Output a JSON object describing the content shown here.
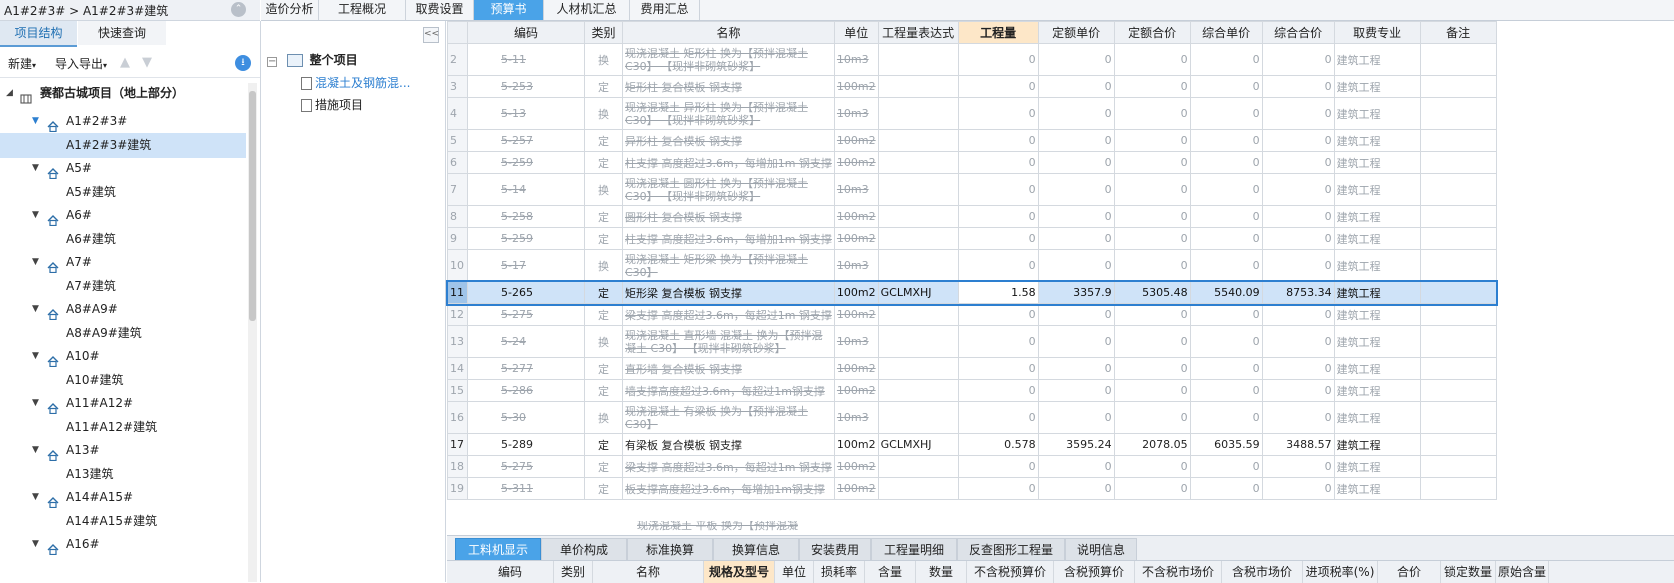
{
  "breadcrumb": "A1#2#3# > A1#2#3#建筑",
  "top_tabs": [
    "造价分析",
    "工程概况",
    "取费设置",
    "预算书",
    "人材机汇总",
    "费用汇总"
  ],
  "active_top_tab": "预算书",
  "left": {
    "tabs": [
      "项目结构",
      "快速查询"
    ],
    "toolbar": {
      "new": "新建",
      "import_export": "导入导出",
      "up_arrow": "▲",
      "down_arrow": "▼",
      "download": "⭳"
    },
    "root": "赛都古城项目（地上部分）",
    "nodes": [
      {
        "name": "A1#2#3#",
        "child": "A1#2#3#建筑"
      },
      {
        "name": "A5#",
        "child": "A5#建筑"
      },
      {
        "name": "A6#",
        "child": "A6#建筑"
      },
      {
        "name": "A7#",
        "child": "A7#建筑"
      },
      {
        "name": "A8#A9#",
        "child": "A8#A9#建筑"
      },
      {
        "name": "A10#",
        "child": "A10#建筑"
      },
      {
        "name": "A11#A12#",
        "child": "A11#A12#建筑"
      },
      {
        "name": "A13#",
        "child": "A13建筑"
      },
      {
        "name": "A14#A15#",
        "child": "A14#A15#建筑"
      },
      {
        "name": "A16#",
        "child": ""
      }
    ],
    "selected": "A1#2#3#建筑"
  },
  "middle": {
    "collapse": "<<",
    "root": "整个项目",
    "items": [
      "混凝土及钢筋混...",
      "措施项目"
    ]
  },
  "grid": {
    "columns": [
      "编码",
      "类别",
      "名称",
      "单位",
      "工程量表达式",
      "工程量",
      "定额单价",
      "定额合价",
      "综合单价",
      "综合合价",
      "取费专业",
      "备注"
    ],
    "rows": [
      {
        "n": "2",
        "code": "5-11",
        "type": "换",
        "name": "现浇混凝土 矩形柱 换为【预拌混凝土 C30】 【现拌非砌筑砂浆】",
        "unit": "10m3",
        "expr": "",
        "qty": "0",
        "up": "0",
        "tp": "0",
        "cup": "0",
        "ctp": "0",
        "spec": "建筑工程",
        "dis": true,
        "tall": true
      },
      {
        "n": "3",
        "code": "5-253",
        "type": "定",
        "name": "矩形柱 复合模板 钢支撑",
        "unit": "100m2",
        "expr": "",
        "qty": "0",
        "up": "0",
        "tp": "0",
        "cup": "0",
        "ctp": "0",
        "spec": "建筑工程",
        "dis": true
      },
      {
        "n": "4",
        "code": "5-13",
        "type": "换",
        "name": "现浇混凝土 异形柱 换为【预拌混凝土 C30】 【现拌非砌筑砂浆】",
        "unit": "10m3",
        "expr": "",
        "qty": "0",
        "up": "0",
        "tp": "0",
        "cup": "0",
        "ctp": "0",
        "spec": "建筑工程",
        "dis": true,
        "tall": true
      },
      {
        "n": "5",
        "code": "5-257",
        "type": "定",
        "name": "异形柱 复合模板 钢支撑",
        "unit": "100m2",
        "expr": "",
        "qty": "0",
        "up": "0",
        "tp": "0",
        "cup": "0",
        "ctp": "0",
        "spec": "建筑工程",
        "dis": true
      },
      {
        "n": "6",
        "code": "5-259",
        "type": "定",
        "name": "柱支撑 高度超过3.6m，每增加1m 钢支撑",
        "unit": "100m2",
        "expr": "",
        "qty": "0",
        "up": "0",
        "tp": "0",
        "cup": "0",
        "ctp": "0",
        "spec": "建筑工程",
        "dis": true
      },
      {
        "n": "7",
        "code": "5-14",
        "type": "换",
        "name": "现浇混凝土 圆形柱 换为【预拌混凝土 C30】 【现拌非砌筑砂浆】",
        "unit": "10m3",
        "expr": "",
        "qty": "0",
        "up": "0",
        "tp": "0",
        "cup": "0",
        "ctp": "0",
        "spec": "建筑工程",
        "dis": true,
        "tall": true
      },
      {
        "n": "8",
        "code": "5-258",
        "type": "定",
        "name": "圆形柱 复合模板 钢支撑",
        "unit": "100m2",
        "expr": "",
        "qty": "0",
        "up": "0",
        "tp": "0",
        "cup": "0",
        "ctp": "0",
        "spec": "建筑工程",
        "dis": true
      },
      {
        "n": "9",
        "code": "5-259",
        "type": "定",
        "name": "柱支撑 高度超过3.6m，每增加1m 钢支撑",
        "unit": "100m2",
        "expr": "",
        "qty": "0",
        "up": "0",
        "tp": "0",
        "cup": "0",
        "ctp": "0",
        "spec": "建筑工程",
        "dis": true
      },
      {
        "n": "10",
        "code": "5-17",
        "type": "换",
        "name": "现浇混凝土 矩形梁 换为【预拌混凝土 C30】",
        "unit": "10m3",
        "expr": "",
        "qty": "0",
        "up": "0",
        "tp": "0",
        "cup": "0",
        "ctp": "0",
        "spec": "建筑工程",
        "dis": true,
        "tall": true
      },
      {
        "n": "11",
        "code": "5-265",
        "type": "定",
        "name": "矩形梁 复合模板 钢支撑",
        "unit": "100m2",
        "expr": "GCLMXHJ",
        "qty": "1.58",
        "up": "3357.9",
        "tp": "5305.48",
        "cup": "5540.09",
        "ctp": "8753.34",
        "spec": "建筑工程",
        "sel": true
      },
      {
        "n": "12",
        "code": "5-275",
        "type": "定",
        "name": "梁支撑 高度超过3.6m，每超过1m 钢支撑",
        "unit": "100m2",
        "expr": "",
        "qty": "0",
        "up": "0",
        "tp": "0",
        "cup": "0",
        "ctp": "0",
        "spec": "建筑工程",
        "dis": true
      },
      {
        "n": "13",
        "code": "5-24",
        "type": "换",
        "name": "现浇混凝土 直形墙 混凝土 换为【预拌混凝土 C30】 【现拌非砌筑砂浆】",
        "unit": "10m3",
        "expr": "",
        "qty": "0",
        "up": "0",
        "tp": "0",
        "cup": "0",
        "ctp": "0",
        "spec": "建筑工程",
        "dis": true,
        "tall": true
      },
      {
        "n": "14",
        "code": "5-277",
        "type": "定",
        "name": "直形墙 复合模板 钢支撑",
        "unit": "100m2",
        "expr": "",
        "qty": "0",
        "up": "0",
        "tp": "0",
        "cup": "0",
        "ctp": "0",
        "spec": "建筑工程",
        "dis": true
      },
      {
        "n": "15",
        "code": "5-286",
        "type": "定",
        "name": "墙支撑高度超过3.6m，每超过1m钢支撑",
        "unit": "100m2",
        "expr": "",
        "qty": "0",
        "up": "0",
        "tp": "0",
        "cup": "0",
        "ctp": "0",
        "spec": "建筑工程",
        "dis": true
      },
      {
        "n": "16",
        "code": "5-30",
        "type": "换",
        "name": "现浇混凝土 有梁板 换为【预拌混凝土 C30】",
        "unit": "10m3",
        "expr": "",
        "qty": "0",
        "up": "0",
        "tp": "0",
        "cup": "0",
        "ctp": "0",
        "spec": "建筑工程",
        "dis": true,
        "tall": true
      },
      {
        "n": "17",
        "code": "5-289",
        "type": "定",
        "name": "有梁板 复合模板 钢支撑",
        "unit": "100m2",
        "expr": "GCLMXHJ",
        "qty": "0.578",
        "up": "3595.24",
        "tp": "2078.05",
        "cup": "6035.59",
        "ctp": "3488.57",
        "spec": "建筑工程"
      },
      {
        "n": "18",
        "code": "5-275",
        "type": "定",
        "name": "梁支撑 高度超过3.6m，每超过1m 钢支撑",
        "unit": "100m2",
        "expr": "",
        "qty": "0",
        "up": "0",
        "tp": "0",
        "cup": "0",
        "ctp": "0",
        "spec": "建筑工程",
        "dis": true
      },
      {
        "n": "19",
        "code": "5-311",
        "type": "定",
        "name": "板支撑高度超过3.6m，每增加1m钢支撑",
        "unit": "100m2",
        "expr": "",
        "qty": "0",
        "up": "0",
        "tp": "0",
        "cup": "0",
        "ctp": "0",
        "spec": "建筑工程",
        "dis": true
      }
    ],
    "partial_row_text": "现浇混凝土 平板 换为【预拌混凝"
  },
  "bottom_tabs": [
    "工料机显示",
    "单价构成",
    "标准换算",
    "换算信息",
    "安装费用",
    "工程量明细",
    "反查图形工程量",
    "说明信息"
  ],
  "active_bottom_tab": "工料机显示",
  "bottom_columns": [
    "编码",
    "类别",
    "名称",
    "规格及型号",
    "单位",
    "损耗率",
    "含量",
    "数量",
    "不含税预算价",
    "含税预算价",
    "不含税市场价",
    "含税市场价",
    "进项税率(%)",
    "合价",
    "锁定数量",
    "原始含量"
  ],
  "colors": {
    "accent": "#4aa3e8",
    "selected_row": "#cfe3f8",
    "header_highlight": "#fde7c8",
    "disabled_text": "#9ea5ad"
  }
}
